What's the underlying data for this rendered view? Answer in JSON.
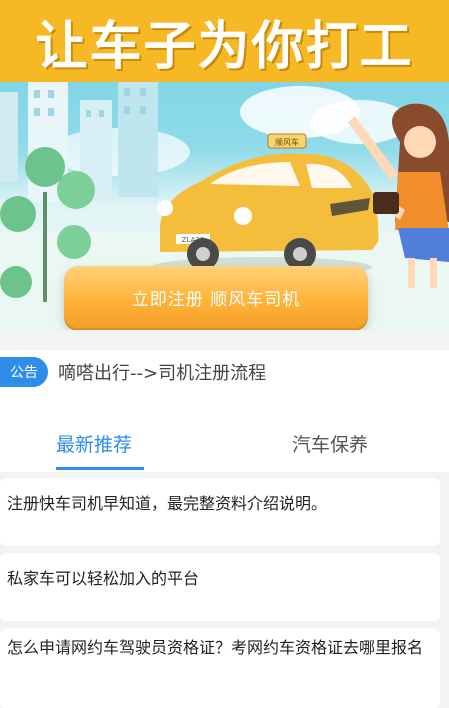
{
  "banner": {
    "title": "让车子为你打工",
    "sign_text": "顺风车",
    "plate_text": "ZLA22",
    "cta_label": "立即注册 顺风车司机"
  },
  "notice": {
    "badge": "公告",
    "text": "嘀嗒出行-->司机注册流程"
  },
  "tabs": [
    {
      "label": "最新推荐",
      "active": true
    },
    {
      "label": "汽车保养",
      "active": false
    }
  ],
  "articles": [
    {
      "title": "注册快车司机早知道，最完整资料介绍说明。"
    },
    {
      "title": "私家车可以轻松加入的平台"
    },
    {
      "title": "怎么申请网约车驾驶员资格证？考网约车资格证去哪里报名"
    }
  ],
  "colors": {
    "accent": "#2f8dea",
    "banner_yellow": "#f7b825",
    "cta_orange": "#ffb33a"
  }
}
